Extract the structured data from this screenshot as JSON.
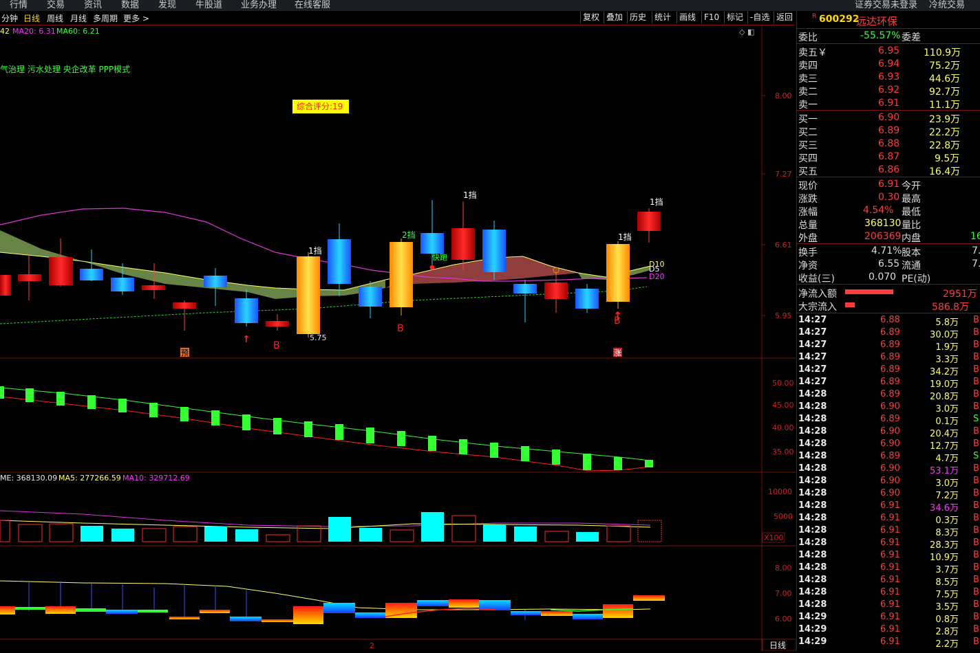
{
  "nav": [
    "行情",
    "交易",
    "资讯",
    "数据",
    "发现",
    "牛股道",
    "业务办理",
    "在线客服",
    "证券交易未登录",
    "冷统交易"
  ],
  "toolbar": {
    "left": [
      "分钟",
      "日线",
      "周线",
      "月线",
      "多周期",
      "更多 >"
    ],
    "right": [
      "复权",
      "叠加",
      "历史",
      "统计",
      "画线",
      "F10",
      "标记",
      "-自选",
      "返回"
    ]
  },
  "colors": {
    "up": "#ff2a2a",
    "down": "#00ffff",
    "neutral": "#e8e8e8",
    "accent": "#ffd800",
    "grid": "#7a1010",
    "ma5": "#ffffff",
    "ma10": "#ffff66",
    "ma20": "#ff33ff",
    "ma60": "#33ff33"
  },
  "main": {
    "ma_legend": [
      {
        "text": "42",
        "color": "#ffff66"
      },
      {
        "text": "MA20: 6.31",
        "color": "#ff33ff"
      },
      {
        "text": "MA60: 6.21",
        "color": "#33ff33"
      }
    ],
    "concepts": "气治理 污水处理 央企改革 PPP模式",
    "score": "综合评分:19",
    "y_ticks": [
      "8.00",
      "7.27",
      "6.61",
      "5.95"
    ],
    "low_marker": "5.75",
    "signals": [
      "1挡",
      "2挡",
      "1挡",
      "1挡",
      "1挡"
    ],
    "kuaipao": "快跑",
    "b_marks": [
      "B",
      "B",
      "B"
    ],
    "tags": [
      "预",
      "涨"
    ],
    "ma_end_labels": [
      "D10",
      "D5",
      "D20"
    ]
  },
  "panel2": {
    "y_ticks": [
      "50.00",
      "45.00",
      "40.00",
      "35.00"
    ]
  },
  "volume": {
    "legend": [
      {
        "text": "ME: 368130.09",
        "color": "#e8e8e8"
      },
      {
        "text": "MA5: 277266.59",
        "color": "#ffff66"
      },
      {
        "text": "MA10: 329712.69",
        "color": "#ff33ff"
      }
    ],
    "y_ticks": [
      "10000",
      "5000"
    ],
    "unit": "X100"
  },
  "panel4": {
    "y_ticks": [
      "8.00",
      "7.00",
      "6.00"
    ],
    "page_marker": "2",
    "period": "日线"
  },
  "quote": {
    "code_prefix": "R",
    "code": "600292",
    "name": "远达环保",
    "weibi_label": "委比",
    "weibi": "-55.57%",
    "weicha_label": "委差",
    "sells": [
      {
        "label": "卖五￥",
        "price": "6.95",
        "vol": "110.9万"
      },
      {
        "label": "卖四",
        "price": "6.94",
        "vol": "75.2万"
      },
      {
        "label": "卖三",
        "price": "6.93",
        "vol": "44.6万"
      },
      {
        "label": "卖二",
        "price": "6.92",
        "vol": "92.7万"
      },
      {
        "label": "卖一",
        "price": "6.91",
        "vol": "11.1万"
      }
    ],
    "buys": [
      {
        "label": "买一",
        "price": "6.90",
        "vol": "23.9万"
      },
      {
        "label": "买二",
        "price": "6.89",
        "vol": "22.2万"
      },
      {
        "label": "买三",
        "price": "6.88",
        "vol": "22.8万"
      },
      {
        "label": "买四",
        "price": "6.87",
        "vol": "9.5万"
      },
      {
        "label": "买五",
        "price": "6.86",
        "vol": "16.4万"
      }
    ],
    "stats": [
      {
        "l": "现价",
        "v": "6.91",
        "c": "#ff3c3c",
        "r": "今开"
      },
      {
        "l": "涨跌",
        "v": "0.30",
        "c": "#ff3c3c",
        "r": "最高"
      },
      {
        "l": "涨幅",
        "v": "4.54%",
        "c": "#ff3c3c",
        "r": "最低"
      },
      {
        "l": "总量",
        "v": "368130",
        "c": "#ffff66",
        "r": "量比"
      },
      {
        "l": "外盘",
        "v": "206369",
        "c": "#ff3c3c",
        "r": "内盘",
        "rv": "16",
        "rc": "#33ff33"
      }
    ],
    "stats2": [
      {
        "l": "换手",
        "v": "4.71%",
        "r": "股本",
        "rv": "7."
      },
      {
        "l": "净资",
        "v": "6.55",
        "r": "流通",
        "rv": "7."
      },
      {
        "l": "收益(三)",
        "v": "0.070",
        "r": "PE(动)",
        "rv": ""
      }
    ],
    "netflow_label": "净流入额",
    "netflow": "2951万",
    "block_label": "大宗流入",
    "block": "586.8万"
  },
  "ticks": [
    {
      "t": "14:27",
      "p": "6.88",
      "v": "5.8万",
      "s": "B"
    },
    {
      "t": "14:27",
      "p": "6.89",
      "v": "30.0万",
      "s": "B"
    },
    {
      "t": "14:27",
      "p": "6.89",
      "v": "1.9万",
      "s": "B"
    },
    {
      "t": "14:27",
      "p": "6.89",
      "v": "3.3万",
      "s": "B"
    },
    {
      "t": "14:27",
      "p": "6.89",
      "v": "34.2万",
      "s": "B"
    },
    {
      "t": "14:27",
      "p": "6.89",
      "v": "19.0万",
      "s": "B"
    },
    {
      "t": "14:28",
      "p": "6.89",
      "v": "20.8万",
      "s": "B"
    },
    {
      "t": "14:28",
      "p": "6.90",
      "v": "3.0万",
      "s": "B"
    },
    {
      "t": "14:28",
      "p": "6.89",
      "v": "0.1万",
      "s": "S"
    },
    {
      "t": "14:28",
      "p": "6.90",
      "v": "20.4万",
      "s": "B"
    },
    {
      "t": "14:28",
      "p": "6.90",
      "v": "12.7万",
      "s": "B"
    },
    {
      "t": "14:28",
      "p": "6.89",
      "v": "4.7万",
      "s": "S"
    },
    {
      "t": "14:28",
      "p": "6.90",
      "v": "53.1万",
      "s": "B"
    },
    {
      "t": "14:28",
      "p": "6.90",
      "v": "3.0万",
      "s": "B"
    },
    {
      "t": "14:28",
      "p": "6.90",
      "v": "7.2万",
      "s": "B"
    },
    {
      "t": "14:28",
      "p": "6.91",
      "v": "34.6万",
      "s": "B"
    },
    {
      "t": "14:28",
      "p": "6.91",
      "v": "0.3万",
      "s": "B"
    },
    {
      "t": "14:28",
      "p": "6.91",
      "v": "8.3万",
      "s": "B"
    },
    {
      "t": "14:28",
      "p": "6.91",
      "v": "28.3万",
      "s": "B"
    },
    {
      "t": "14:28",
      "p": "6.91",
      "v": "10.9万",
      "s": "B"
    },
    {
      "t": "14:28",
      "p": "6.91",
      "v": "3.7万",
      "s": "B"
    },
    {
      "t": "14:28",
      "p": "6.91",
      "v": "8.5万",
      "s": "B"
    },
    {
      "t": "14:28",
      "p": "6.91",
      "v": "7.5万",
      "s": "B"
    },
    {
      "t": "14:28",
      "p": "6.91",
      "v": "3.5万",
      "s": "B"
    },
    {
      "t": "14:29",
      "p": "6.91",
      "v": "0.8万",
      "s": "B"
    },
    {
      "t": "14:29",
      "p": "6.91",
      "v": "2.8万",
      "s": "B"
    },
    {
      "t": "14:29",
      "p": "6.91",
      "v": "2.2万",
      "s": "B"
    }
  ]
}
